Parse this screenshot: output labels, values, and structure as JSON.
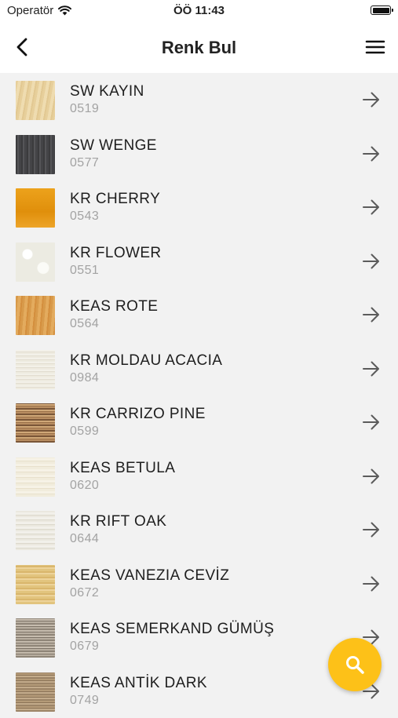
{
  "status_bar": {
    "carrier": "Operatör",
    "time": "ÖÖ 11:43"
  },
  "nav": {
    "title": "Renk Bul"
  },
  "items": [
    {
      "name": "SW KAYIN",
      "code": "0519"
    },
    {
      "name": "SW WENGE",
      "code": "0577"
    },
    {
      "name": "KR CHERRY",
      "code": "0543"
    },
    {
      "name": "KR FLOWER",
      "code": "0551"
    },
    {
      "name": "KEAS ROTE",
      "code": "0564"
    },
    {
      "name": "KR MOLDAU ACACIA",
      "code": "0984"
    },
    {
      "name": "KR CARRIZO PINE",
      "code": "0599"
    },
    {
      "name": "KEAS BETULA",
      "code": "0620"
    },
    {
      "name": "KR RIFT OAK",
      "code": "0644"
    },
    {
      "name": "KEAS VANEZIA CEVİZ",
      "code": "0672"
    },
    {
      "name": "KEAS SEMERKAND GÜMÜŞ",
      "code": "0679"
    },
    {
      "name": "KEAS ANTİK DARK",
      "code": "0749"
    }
  ],
  "colors": {
    "accent": "#fdc118",
    "background": "#f2f2f2"
  },
  "icons": {
    "back": "chevron-left-icon",
    "menu": "hamburger-menu-icon",
    "row": "arrow-right-icon",
    "fab": "search-icon"
  }
}
